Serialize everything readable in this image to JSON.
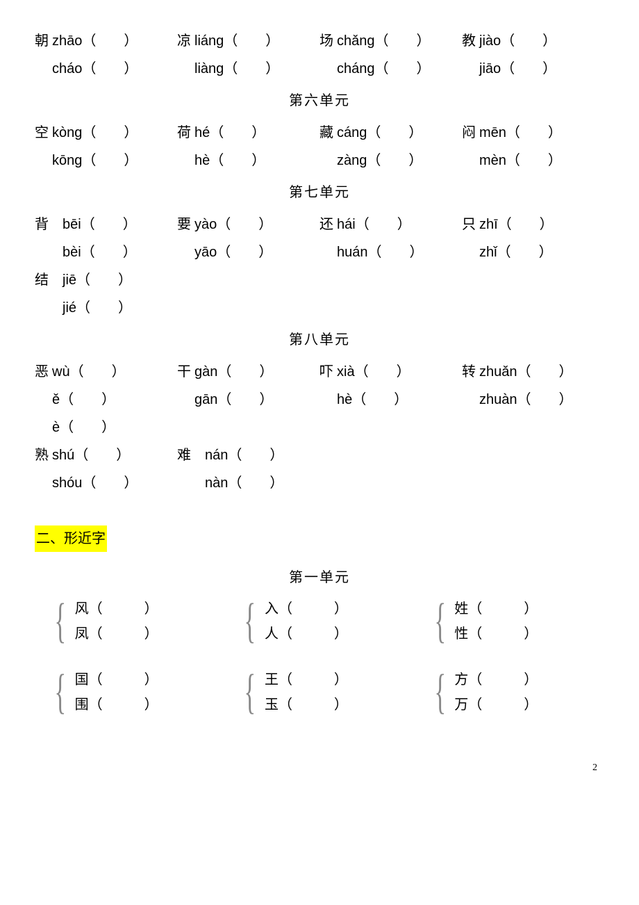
{
  "unit5": {
    "rows": [
      [
        {
          "char": "朝",
          "pinyin": "zhāo"
        },
        {
          "char": "凉",
          "pinyin": "liáng"
        },
        {
          "char": "场",
          "pinyin": "chǎng"
        },
        {
          "char": "教",
          "pinyin": "jiào"
        }
      ],
      [
        {
          "char": "",
          "pinyin": "cháo"
        },
        {
          "char": "",
          "pinyin": "liàng"
        },
        {
          "char": "",
          "pinyin": "cháng"
        },
        {
          "char": "",
          "pinyin": "jiāo"
        }
      ]
    ]
  },
  "unit6": {
    "title": "第六单元",
    "rows": [
      [
        {
          "char": "空",
          "pinyin": "kòng"
        },
        {
          "char": "荷",
          "pinyin": "hé"
        },
        {
          "char": "藏",
          "pinyin": "cáng"
        },
        {
          "char": "闷",
          "pinyin": "mēn"
        }
      ],
      [
        {
          "char": "",
          "pinyin": "kōng"
        },
        {
          "char": "",
          "pinyin": "hè"
        },
        {
          "char": "",
          "pinyin": "zàng"
        },
        {
          "char": "",
          "pinyin": "mèn"
        }
      ]
    ]
  },
  "unit7": {
    "title": "第七单元",
    "rows": [
      [
        {
          "char": "背",
          "pinyin": "bēi"
        },
        {
          "char": "要",
          "pinyin": "yào"
        },
        {
          "char": "还",
          "pinyin": "hái"
        },
        {
          "char": "只",
          "pinyin": "zhī"
        }
      ],
      [
        {
          "char": "",
          "pinyin": "bèi"
        },
        {
          "char": "",
          "pinyin": "yāo"
        },
        {
          "char": "",
          "pinyin": "huán"
        },
        {
          "char": "",
          "pinyin": "zhǐ"
        }
      ],
      [
        {
          "char": "结",
          "pinyin": "jiē"
        }
      ],
      [
        {
          "char": "",
          "pinyin": "jié"
        }
      ]
    ]
  },
  "unit8": {
    "title": "第八单元",
    "rows": [
      [
        {
          "char": "恶",
          "pinyin": "wù"
        },
        {
          "char": "干",
          "pinyin": "gàn"
        },
        {
          "char": "吓",
          "pinyin": "xià"
        },
        {
          "char": "转",
          "pinyin": "zhuǎn"
        }
      ],
      [
        {
          "char": "",
          "pinyin": "ě"
        },
        {
          "char": "",
          "pinyin": "gān"
        },
        {
          "char": "",
          "pinyin": "hè"
        },
        {
          "char": "",
          "pinyin": "zhuàn"
        }
      ],
      [
        {
          "char": "",
          "pinyin": "è"
        }
      ],
      [
        {
          "char": "熟",
          "pinyin": "shú"
        },
        {
          "char": "难",
          "pinyin": "nán"
        }
      ],
      [
        {
          "char": "",
          "pinyin": "shóu"
        },
        {
          "char": "",
          "pinyin": "nàn"
        }
      ]
    ]
  },
  "section2": {
    "title": "二、形近字",
    "unit1_title": "第一单元",
    "groups": [
      [
        [
          "风",
          "凤"
        ],
        [
          "入",
          "人"
        ],
        [
          "姓",
          "性"
        ]
      ],
      [
        [
          "国",
          "围"
        ],
        [
          "王",
          "玉"
        ],
        [
          "方",
          "万"
        ]
      ]
    ]
  },
  "page_num": "2"
}
